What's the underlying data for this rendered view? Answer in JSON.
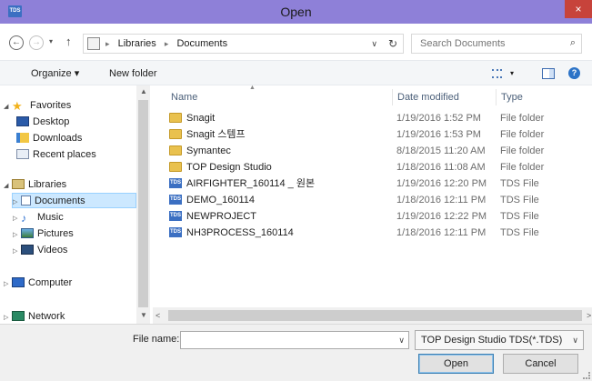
{
  "window": {
    "title": "Open",
    "app_icon_text": "TDS",
    "close_glyph": "×"
  },
  "address": {
    "back_glyph": "←",
    "forward_glyph": "→",
    "recent_glyph": "▾",
    "up_glyph": "↑",
    "separator": "▸",
    "crumbs": [
      "Libraries",
      "Documents"
    ],
    "dropdown_glyph": "∨",
    "refresh_glyph": "↻"
  },
  "search": {
    "placeholder": "Search Documents",
    "icon": "search-icon",
    "glyph": "⌕"
  },
  "toolbar": {
    "organize_label": "Organize ▾",
    "new_folder_label": "New folder",
    "view_dropdown_glyph": "▾",
    "help_glyph": "?"
  },
  "nav": {
    "favorites": {
      "label": "Favorites",
      "items": [
        {
          "label": "Desktop",
          "icon": "desktop-icon"
        },
        {
          "label": "Downloads",
          "icon": "downloads-icon"
        },
        {
          "label": "Recent places",
          "icon": "recent-places-icon"
        }
      ]
    },
    "libraries": {
      "label": "Libraries",
      "items": [
        {
          "label": "Documents",
          "icon": "documents-icon",
          "selected": true
        },
        {
          "label": "Music",
          "icon": "music-icon"
        },
        {
          "label": "Pictures",
          "icon": "pictures-icon"
        },
        {
          "label": "Videos",
          "icon": "videos-icon"
        }
      ]
    },
    "computer": {
      "label": "Computer"
    },
    "network": {
      "label": "Network"
    },
    "expand_open_glyph": "◢",
    "expand_closed_glyph": "▷"
  },
  "filelist": {
    "columns": {
      "name": "Name",
      "date": "Date modified",
      "type": "Type"
    },
    "rows": [
      {
        "name": "Snagit",
        "date": "1/19/2016 1:52 PM",
        "type": "File folder",
        "kind": "folder"
      },
      {
        "name": "Snagit 스템프",
        "date": "1/19/2016 1:53 PM",
        "type": "File folder",
        "kind": "folder"
      },
      {
        "name": "Symantec",
        "date": "8/18/2015 11:20 AM",
        "type": "File folder",
        "kind": "folder"
      },
      {
        "name": "TOP Design Studio",
        "date": "1/18/2016 11:08 AM",
        "type": "File folder",
        "kind": "folder"
      },
      {
        "name": "AIRFIGHTER_160114 _ 원본",
        "date": "1/19/2016 12:20 PM",
        "type": "TDS File",
        "kind": "tds"
      },
      {
        "name": "DEMO_160114",
        "date": "1/18/2016 12:11 PM",
        "type": "TDS File",
        "kind": "tds"
      },
      {
        "name": "NEWPROJECT",
        "date": "1/19/2016 12:22 PM",
        "type": "TDS File",
        "kind": "tds"
      },
      {
        "name": "NH3PROCESS_160114",
        "date": "1/18/2016 12:11 PM",
        "type": "TDS File",
        "kind": "tds"
      }
    ],
    "tds_icon_text": "TDS"
  },
  "scrollbar": {
    "up_glyph": "▲",
    "down_glyph": "▼",
    "left_glyph": "<",
    "right_glyph": ">"
  },
  "footer": {
    "file_name_label": "File name:",
    "file_name_value": "",
    "dropdown_glyph": "∨",
    "filter_label": "TOP Design Studio TDS(*.TDS)",
    "filter_glyph": "∨",
    "open_label": "Open",
    "cancel_label": "Cancel"
  },
  "colors": {
    "titlebar": "#8e80d8",
    "close_button": "#c7433b",
    "selection": "#cce8ff",
    "folder": "#e9c14e",
    "tds_icon": "#3b6fc2"
  }
}
